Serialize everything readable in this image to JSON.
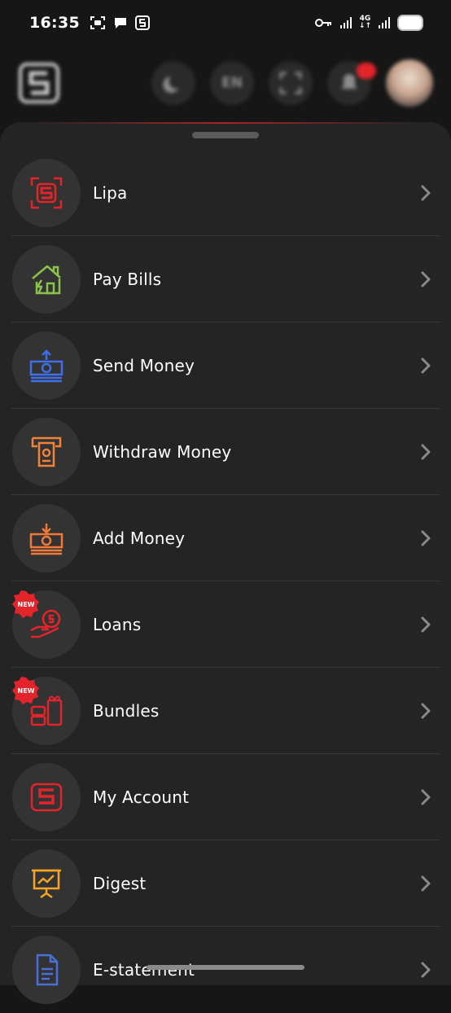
{
  "status_bar": {
    "time": "16:35",
    "network": "4G",
    "left_icons": [
      "screenshot-icon",
      "chat-icon",
      "app-s-icon"
    ],
    "right_icons": [
      "key-icon",
      "signal-icon",
      "signal-icon",
      "battery-icon"
    ]
  },
  "header": {
    "language": "EN",
    "icons": [
      "logo-icon",
      "moon-icon",
      "scan-icon",
      "bell-icon"
    ]
  },
  "menu": {
    "items": [
      {
        "label": "Lipa",
        "icon": "scan-pay-icon",
        "color": "#e3242b",
        "new": false
      },
      {
        "label": "Pay Bills",
        "icon": "house-icon",
        "color": "#8bc34a",
        "new": false
      },
      {
        "label": "Send Money",
        "icon": "cash-up-icon",
        "color": "#3f6ee8",
        "new": false
      },
      {
        "label": "Withdraw Money",
        "icon": "atm-icon",
        "color": "#f0833a",
        "new": false
      },
      {
        "label": "Add Money",
        "icon": "cash-down-icon",
        "color": "#f07a3c",
        "new": false
      },
      {
        "label": "Loans",
        "icon": "hand-coin-icon",
        "color": "#e3242b",
        "new": true
      },
      {
        "label": "Bundles",
        "icon": "gift-icon",
        "color": "#e3242b",
        "new": true
      },
      {
        "label": "My Account",
        "icon": "logo-icon",
        "color": "#e3242b",
        "new": false
      },
      {
        "label": "Digest",
        "icon": "presentation-icon",
        "color": "#f5a623",
        "new": false
      },
      {
        "label": "E-statement",
        "icon": "document-icon",
        "color": "#4a6fd6",
        "new": false
      }
    ],
    "new_badge_text": "NEW"
  },
  "colors": {
    "background": "#161616",
    "sheet": "#242424",
    "accent": "#e3242b"
  }
}
